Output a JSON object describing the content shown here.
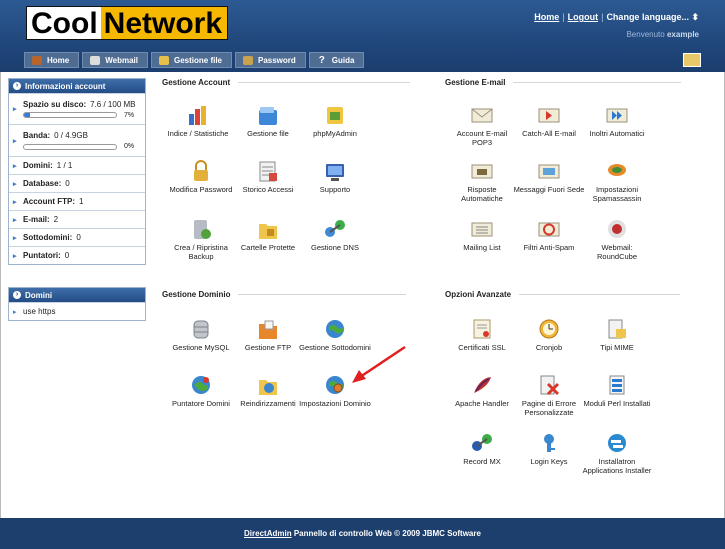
{
  "brand": {
    "part1": "Cool",
    "part2": "Network"
  },
  "toplinks": {
    "home": "Home",
    "logout": "Logout",
    "language": "Change language... ⬍"
  },
  "welcome": {
    "prefix": "Benvenuto",
    "user": "example"
  },
  "tabs": [
    {
      "label": "Home",
      "icon": "house-icon",
      "color": "#b9642a"
    },
    {
      "label": "Webmail",
      "icon": "envelope-icon",
      "color": "#dcdcdc"
    },
    {
      "label": "Gestione file",
      "icon": "folder-icon",
      "color": "#e7c04a"
    },
    {
      "label": "Password",
      "icon": "key-icon",
      "color": "#c9a34e"
    },
    {
      "label": "Guida",
      "icon": "question-icon",
      "color": "#ffffff"
    }
  ],
  "account": {
    "title": "Informazioni account",
    "disk_label": "Spazio su disco:",
    "disk_value": "7.6 / 100 MB",
    "disk_pct": "7%",
    "disk_fraction": 0.07,
    "band_label": "Banda:",
    "band_value": "0 / 4.9GB",
    "band_pct": "0%",
    "band_fraction": 0,
    "rows": [
      {
        "label": "Domini:",
        "value": "1 / 1"
      },
      {
        "label": "Database:",
        "value": "0"
      },
      {
        "label": "Account FTP:",
        "value": "1"
      },
      {
        "label": "E-mail:",
        "value": "2"
      },
      {
        "label": "Sottodomini:",
        "value": "0"
      },
      {
        "label": "Puntatori:",
        "value": "0"
      }
    ]
  },
  "domains": {
    "title": "Domini",
    "items": [
      "use https"
    ]
  },
  "sections": {
    "account_mgmt": {
      "title": "Gestione Account",
      "items": [
        {
          "label": "Indice / Statistiche",
          "icon": "statistics-icon"
        },
        {
          "label": "Gestione file",
          "icon": "file-manager-icon"
        },
        {
          "label": "phpMyAdmin",
          "icon": "phpmyadmin-icon"
        },
        {
          "label": "Modifica Password",
          "icon": "padlock-icon"
        },
        {
          "label": "Storico Accessi",
          "icon": "access-log-icon"
        },
        {
          "label": "Supporto",
          "icon": "support-icon"
        },
        {
          "label": "Crea / Ripristina Backup",
          "icon": "backup-icon"
        },
        {
          "label": "Cartelle Protette",
          "icon": "protected-folder-icon"
        },
        {
          "label": "Gestione DNS",
          "icon": "dns-icon"
        }
      ]
    },
    "email_mgmt": {
      "title": "Gestione E-mail",
      "items": [
        {
          "label": "Account E-mail POP3",
          "icon": "pop3-envelope-icon"
        },
        {
          "label": "Catch-All E-mail",
          "icon": "catch-all-icon"
        },
        {
          "label": "Inoltri Automatici",
          "icon": "forwarders-icon"
        },
        {
          "label": "Risposte Automatiche",
          "icon": "autoresponder-icon"
        },
        {
          "label": "Messaggi Fuori Sede",
          "icon": "vacation-icon"
        },
        {
          "label": "Impostazioni Spamassassin",
          "icon": "spamassassin-icon"
        },
        {
          "label": "Mailing List",
          "icon": "mailing-list-icon"
        },
        {
          "label": "Filtri Anti-Spam",
          "icon": "spam-filter-icon"
        },
        {
          "label": "Webmail: RoundCube",
          "icon": "roundcube-icon"
        }
      ]
    },
    "domain_mgmt": {
      "title": "Gestione Dominio",
      "items": [
        {
          "label": "Gestione MySQL",
          "icon": "mysql-database-icon"
        },
        {
          "label": "Gestione FTP",
          "icon": "ftp-folder-icon"
        },
        {
          "label": "Gestione Sottodomini",
          "icon": "subdomain-globe-icon"
        },
        {
          "label": "Puntatore Domini",
          "icon": "domain-pointer-globe-icon"
        },
        {
          "label": "Reindirizzamenti",
          "icon": "redirect-icon"
        },
        {
          "label": "Impostazioni Dominio",
          "icon": "domain-settings-icon"
        }
      ]
    },
    "advanced": {
      "title": "Opzioni Avanzate",
      "items": [
        {
          "label": "Certificati SSL",
          "icon": "ssl-certificate-icon"
        },
        {
          "label": "Cronjob",
          "icon": "cron-clock-icon"
        },
        {
          "label": "Tipi MIME",
          "icon": "mime-types-icon"
        },
        {
          "label": "Apache Handler",
          "icon": "apache-feather-icon"
        },
        {
          "label": "Pagine di Errore Personalizzate",
          "icon": "error-pages-icon"
        },
        {
          "label": "Moduli Perl Installati",
          "icon": "perl-modules-icon"
        },
        {
          "label": "Record MX",
          "icon": "mx-record-icon"
        },
        {
          "label": "Login Keys",
          "icon": "login-keys-icon"
        },
        {
          "label": "Installatron Applications Installer",
          "icon": "installatron-icon"
        }
      ]
    }
  },
  "footer": {
    "link": "DirectAdmin",
    "text": "Pannello di controllo Web © 2009 JBMC Software"
  }
}
